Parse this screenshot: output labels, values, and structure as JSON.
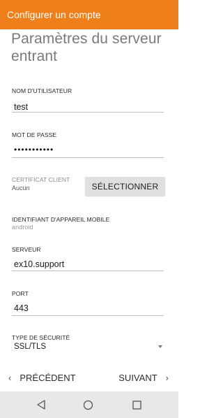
{
  "appbar": {
    "title": "Configurer un compte",
    "color": "#ef7f1a"
  },
  "page_title": "Paramètres du serveur entrant",
  "username": {
    "label": "NOM D'UTILISATEUR",
    "value": "test"
  },
  "password": {
    "label": "MOT DE PASSE",
    "value": "•••••••••••"
  },
  "certificate": {
    "label": "CERTIFICAT CLIENT",
    "value": "Aucun",
    "button_label": "SÉLECTIONNER"
  },
  "device_id": {
    "label": "IDENTIFIANT D'APPAREIL MOBILE",
    "value": "android"
  },
  "server": {
    "label": "SERVEUR",
    "value": "ex10.support"
  },
  "port": {
    "label": "PORT",
    "value": "443"
  },
  "security": {
    "label": "TYPE DE SÉCURITÉ",
    "value": "SSL/TLS"
  },
  "navigation": {
    "prev_label": "PRÉCÉDENT",
    "next_label": "SUIVANT"
  },
  "system_nav": {
    "back_icon": "back-triangle-icon",
    "home_icon": "home-circle-icon",
    "recent_icon": "recent-square-icon"
  }
}
